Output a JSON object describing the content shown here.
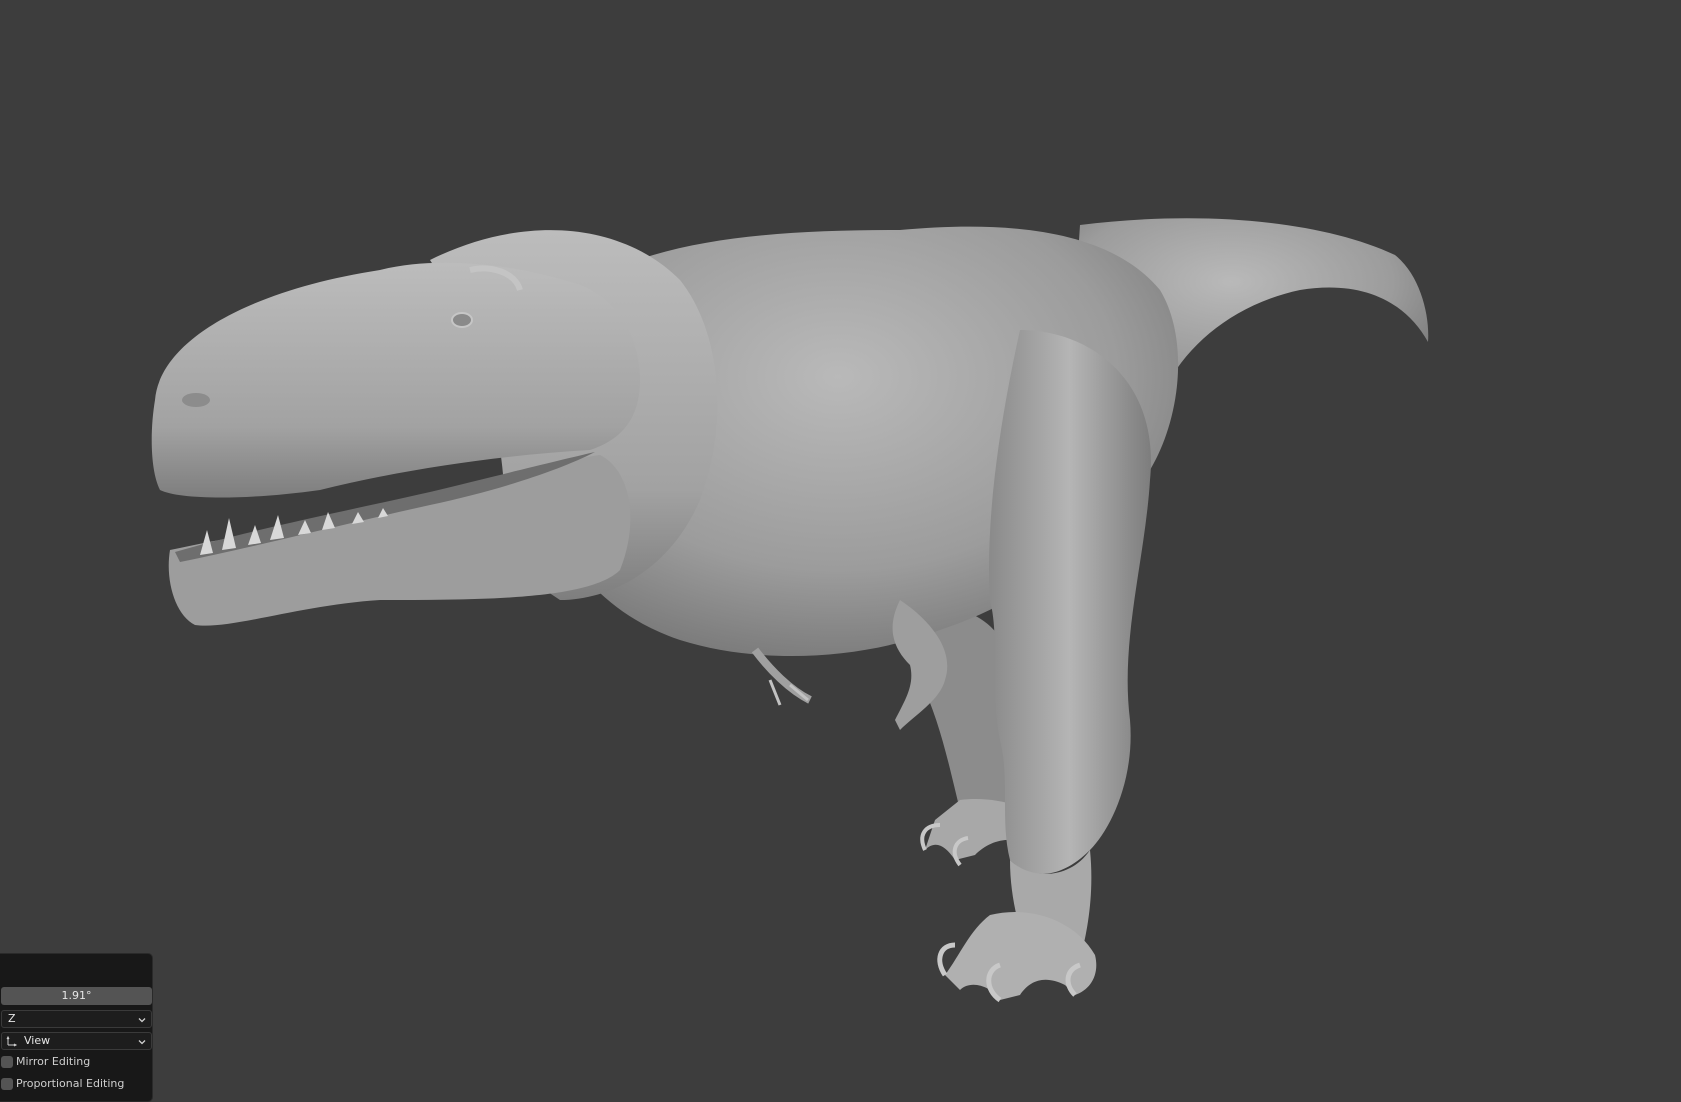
{
  "viewport": {
    "background_color": "#3d3d3d",
    "model_color": "#a9a9a9",
    "model_name_icon": "trex-model"
  },
  "redo_panel": {
    "angle_value": "1.91°",
    "axis_dropdown": {
      "selected": "Z"
    },
    "orientation_dropdown": {
      "selected": "View",
      "icon": "orientation-icon"
    },
    "mirror_editing": {
      "label": "Mirror Editing",
      "checked": false
    },
    "proportional_editing": {
      "label": "Proportional Editing",
      "checked": false
    }
  }
}
